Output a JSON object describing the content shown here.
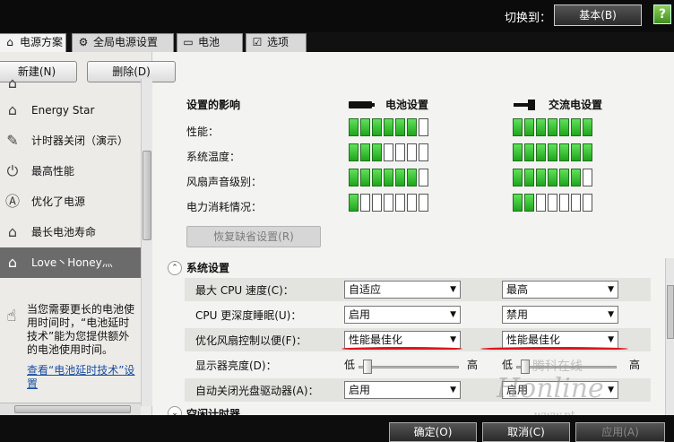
{
  "header": {
    "switch_label": "切换到：",
    "mode_button": "基本(B)",
    "help_glyph": "?"
  },
  "tabs": [
    {
      "label": "电源方案",
      "icon": "power-plan-icon"
    },
    {
      "label": "全局电源设置",
      "icon": "gear-icon"
    },
    {
      "label": "电池",
      "icon": "battery-icon"
    },
    {
      "label": "选项",
      "icon": "checkbox-icon"
    }
  ],
  "left": {
    "new_button": "新建(N)",
    "delete_button": "删除(D)",
    "plans": [
      {
        "label": "",
        "icon": "house-icon"
      },
      {
        "label": "Energy Star",
        "icon": "house-icon"
      },
      {
        "label": "计时器关闭（演示）",
        "icon": "projector-icon"
      },
      {
        "label": "最高性能",
        "icon": "power-icon"
      },
      {
        "label": "优化了电源",
        "icon": "a-circle-icon"
      },
      {
        "label": "最长电池寿命",
        "icon": "battery-house-icon"
      },
      {
        "label": "Love丶Honey灬",
        "icon": "house-icon",
        "selected": true
      }
    ],
    "tip_text": "当您需要更长的电池使用时间时，“电池延时技术”能为您提供额外的电池使用时间。",
    "tip_link": "查看“电池延时技术”设置"
  },
  "impact": {
    "heading": "设置的影响",
    "battery_heading": "电池设置",
    "ac_heading": "交流电设置",
    "rows": [
      {
        "label": "性能：",
        "battery": 6,
        "ac": 7
      },
      {
        "label": "系统温度：",
        "battery": 3,
        "ac": 7
      },
      {
        "label": "风扇声音级别：",
        "battery": 6,
        "ac": 6
      },
      {
        "label": "电力消耗情况：",
        "battery": 1,
        "ac": 2
      }
    ],
    "max_level": 7,
    "restore_button": "恢复缺省设置(R)"
  },
  "system": {
    "title": "系统设置",
    "rows": [
      {
        "label": "最大 CPU 速度(C)：",
        "battery": "自适应",
        "ac": "最高"
      },
      {
        "label": "CPU 更深度睡眠(U)：",
        "battery": "启用",
        "ac": "禁用"
      },
      {
        "label": "优化风扇控制以便(F)：",
        "battery": "性能最佳化",
        "ac": "性能最佳化"
      },
      {
        "label": "显示器亮度(D)：",
        "battery_low": "低",
        "battery_high": "高",
        "ac_low": "低",
        "ac_high": "高",
        "battery_level": 0.05,
        "ac_level": 0.05
      },
      {
        "label": "自动关闭光盘驱动器(A)：",
        "battery": "启用",
        "ac": "启用"
      }
    ],
    "next_section": "空闲计时器"
  },
  "footer": {
    "ok": "确定(O)",
    "cancel": "取消(C)",
    "apply": "应用(A)"
  },
  "watermark": {
    "line1": "腾科在线",
    "line2": "Honline",
    "url": "www.pt"
  },
  "colors": {
    "meter_on": "#2fbf2a",
    "selection": "#6b6b6b",
    "annotation": "#e0141b"
  }
}
